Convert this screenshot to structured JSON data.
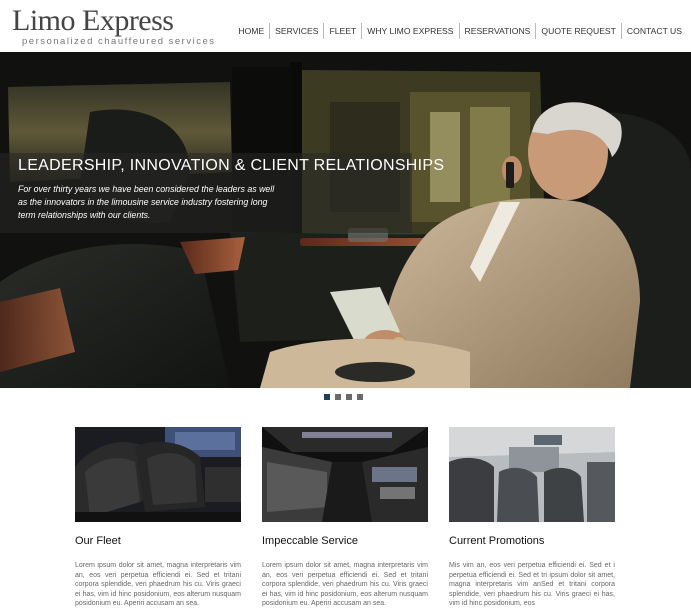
{
  "brand": {
    "title": "Limo Express",
    "tagline": "personalized chauffeured services"
  },
  "nav": {
    "items": [
      {
        "label": "HOME"
      },
      {
        "label": "SERVICES"
      },
      {
        "label": "FLEET"
      },
      {
        "label": "WHY LIMO EXPRESS"
      },
      {
        "label": "RESERVATIONS"
      },
      {
        "label": "QUOTE REQUEST"
      },
      {
        "label": "CONTACT US"
      }
    ]
  },
  "hero": {
    "title": "LEADERSHIP, INNOVATION & CLIENT RELATIONSHIPS",
    "text": "For over thirty years we have been considered the leaders as well as the innovators in the limousine service industry fostering long term relationships with our clients.",
    "slide_count": 4,
    "active_slide": 1
  },
  "features": [
    {
      "title": "Our Fleet",
      "text": "Lorem ipsum dolor sit amet, magna interpretaris vim an, eos veri perpetua efficiendi ei. Sed et tritani corpora splendide, veri phaedrum his cu. Viris graeci ei has, vim id hinc posidonium, eos alterum nusquam posidonium eu. Aperiri accusam an sea."
    },
    {
      "title": "Impeccable Service",
      "text": "Lorem ipsum dolor sit amet, magna interpretaris vim an, eos veri perpetua efficiendi ei. Sed et tritani corpora splendide, veri phaedrum his cu. Viris graeci ei has, vim id hinc posidonium, eos alterum nusquam posidonium eu. Aperiri accusam an sea."
    },
    {
      "title": "Current Promotions",
      "text": "Mis vim an, eos veri perpetua efficiendi ei. Sed et i perpetua efficiendi ei. Sed et tri ipsum dolor sit amet, magna interpretaris vim anSed et tritani corpora splendide, veri phaedrum his cu. Viris graeci ei has, vim id hinc posidonium, eos"
    }
  ],
  "colors": {
    "active_dot": "#1f3d60",
    "inactive_dot": "#6a6a6a"
  }
}
